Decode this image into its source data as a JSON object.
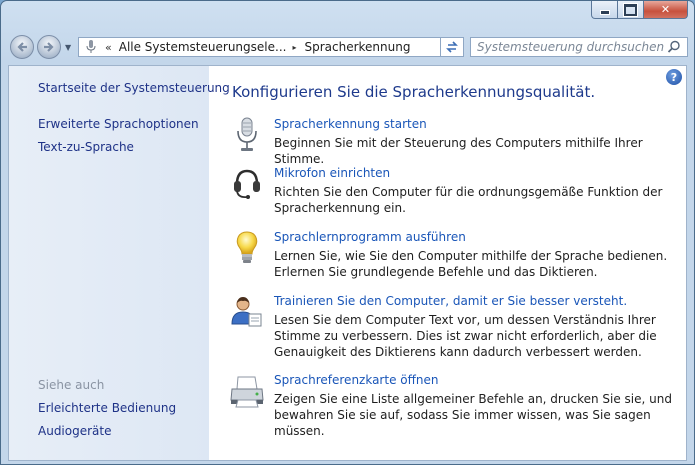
{
  "window": {
    "minimize_glyph": "",
    "maximize_glyph": "",
    "close_glyph": "✕"
  },
  "navigation": {
    "back_icon": "back-arrow-icon",
    "forward_icon": "forward-arrow-icon",
    "address": {
      "overflow_chevron": "«",
      "crumb_parent": "Alle Systemsteuerungsele...",
      "separator": "▸",
      "crumb_current": "Spracherkennung"
    },
    "search": {
      "placeholder": "Systemsteuerung durchsuchen"
    }
  },
  "sidebar": {
    "home_link": "Startseite der Systemsteuerung",
    "links": [
      "Erweiterte Sprachoptionen",
      "Text-zu-Sprache"
    ],
    "see_also_heading": "Siehe auch",
    "see_also": [
      "Erleichterte Bedienung",
      "Audiogeräte"
    ]
  },
  "main": {
    "title": "Konfigurieren Sie die Spracherkennungsqualität.",
    "help_glyph": "?",
    "tasks": [
      {
        "icon": "microphone-icon",
        "link": "Spracherkennung starten",
        "desc": "Beginnen Sie mit der Steuerung des Computers mithilfe Ihrer Stimme."
      },
      {
        "icon": "headset-icon",
        "link": "Mikrofon einrichten",
        "desc": "Richten Sie den Computer für die ordnungsgemäße Funktion der Spracherkennung ein."
      },
      {
        "icon": "lightbulb-icon",
        "link": "Sprachlernprogramm ausführen",
        "desc": "Lernen Sie, wie Sie den Computer mithilfe der Sprache bedienen. Erlernen Sie grundlegende Befehle und das Diktieren."
      },
      {
        "icon": "user-training-icon",
        "link": "Trainieren Sie den Computer, damit er Sie besser versteht.",
        "desc": "Lesen Sie dem Computer Text vor, um dessen Verständnis Ihrer Stimme zu verbessern. Dies ist zwar nicht erforderlich, aber die Genauigkeit des Diktierens kann dadurch verbessert werden."
      },
      {
        "icon": "printer-icon",
        "link": "Sprachreferenzkarte öffnen",
        "desc": "Zeigen Sie eine Liste allgemeiner Befehle an, drucken Sie sie, und bewahren Sie sie auf, sodass Sie immer wissen, was Sie sagen müssen."
      }
    ]
  }
}
